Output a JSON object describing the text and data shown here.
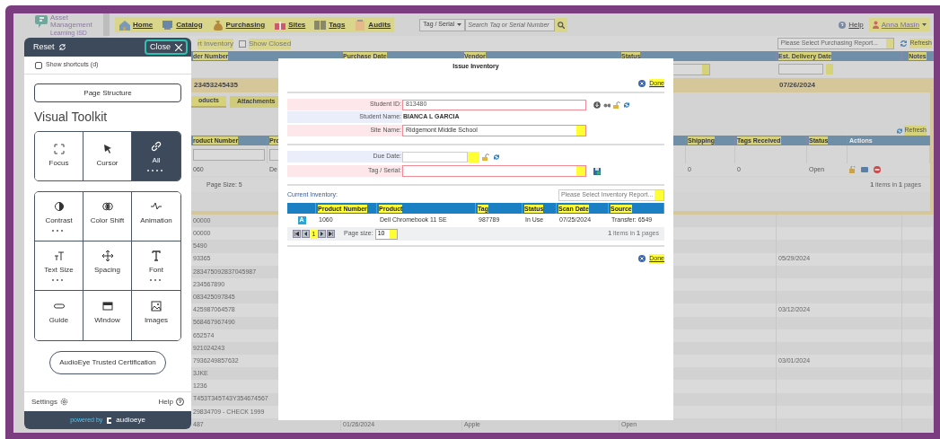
{
  "app": {
    "logo": {
      "line1": "Asset",
      "line2": "Management",
      "district": "Learning ISD"
    },
    "nav": [
      {
        "label": "Home"
      },
      {
        "label": "Catalog"
      },
      {
        "label": "Purchasing"
      },
      {
        "label": "Sites"
      },
      {
        "label": "Tags"
      },
      {
        "label": "Audits"
      }
    ],
    "search": {
      "type_select": "Tag / Serial",
      "placeholder": "Search Tag or Serial Number"
    },
    "help": "Help",
    "user": "Anna Masin"
  },
  "toolbar": {
    "import_link": "rt Inventory",
    "show_closed": {
      "label": "Show Closed",
      "checked": false
    },
    "report_select": {
      "placeholder": "Please Select Purchasing Report..."
    },
    "refresh": "Refresh"
  },
  "orders": {
    "columns": [
      "der Number",
      "Purchase Date",
      "Vendor",
      "Status",
      "Est. Delivery Date",
      "Notes"
    ],
    "expanded_row": {
      "order_number": "23453245435",
      "est_delivery_date": "07/26/2024"
    },
    "detail": {
      "tabs": [
        {
          "label": "oducts",
          "selected": true
        },
        {
          "label": "Attachments",
          "selected": false
        }
      ],
      "refresh": "Refresh",
      "columns": [
        "roduct Number",
        "Pro",
        "Shipping",
        "Tags Received",
        "Status",
        "Actions"
      ],
      "row": {
        "product_number": "060",
        "product": "De",
        "shipping": "0",
        "tags_received": "0",
        "status": "Open"
      },
      "page_size": "Page Size: 5",
      "summary": "**1** items in **1** pages"
    },
    "rows": [
      {
        "number": "00000"
      },
      {
        "number": "00000"
      },
      {
        "number": "5490"
      },
      {
        "number": "93365",
        "est_delivery_date": "05/29/2024"
      },
      {
        "number": "283475092837045987"
      },
      {
        "number": "234567890"
      },
      {
        "number": "083425097845"
      },
      {
        "number": "425987064578",
        "est_delivery_date": "03/12/2024"
      },
      {
        "number": "568467967490"
      },
      {
        "number": "652574"
      },
      {
        "number": "921024243"
      },
      {
        "number": "7936249857632",
        "est_delivery_date": "03/01/2024"
      },
      {
        "number": "3JKE"
      },
      {
        "number": "1236"
      },
      {
        "number": "T453T345T43Y354674567"
      },
      {
        "number": "29834709 - CHECK 1999"
      },
      {
        "number": "487",
        "purchase_date": "01/26/2024",
        "vendor": "Apple",
        "status": "Open"
      }
    ]
  },
  "toolkit": {
    "reset": "Reset",
    "close": "Close",
    "show_shortcuts": {
      "label": "Show shortcuts (d)",
      "checked": false
    },
    "page_structure": "Page Structure",
    "heading": "Visual Toolkit",
    "top_tools": [
      {
        "label": "Focus",
        "selected": false,
        "has_options": false
      },
      {
        "label": "Cursor",
        "selected": false,
        "has_options": false
      },
      {
        "label": "All",
        "selected": true,
        "has_options": true
      }
    ],
    "tools": [
      {
        "label": "Contrast",
        "has_options": true
      },
      {
        "label": "Color Shift",
        "has_options": false
      },
      {
        "label": "Animation",
        "has_options": false
      },
      {
        "label": "Text Size",
        "has_options": true
      },
      {
        "label": "Spacing",
        "has_options": false
      },
      {
        "label": "Font",
        "has_options": true
      },
      {
        "label": "Guide",
        "has_options": false
      },
      {
        "label": "Window",
        "has_options": false
      },
      {
        "label": "Images",
        "has_options": false
      }
    ],
    "certification": "AudioEye Trusted Certification",
    "settings": "Settings",
    "help": "Help",
    "powered_by": "powered by",
    "brand": "audioeye"
  },
  "modal": {
    "title": "Issue Inventory",
    "done": "Done",
    "student_id": {
      "label": "Student ID:",
      "value": "813480"
    },
    "student_name": {
      "label": "Student Name:",
      "value": "BIANCA L GARCIA"
    },
    "site_name": {
      "label": "Site Name:",
      "value": "Ridgemont Middle School"
    },
    "due_date": {
      "label": "Due Date:"
    },
    "tag_serial": {
      "label": "Tag / Serial:"
    },
    "current_inventory": "Current Inventory:",
    "inventory_report": {
      "placeholder": "Please Select Inventory Report..."
    },
    "columns": [
      "Product Number",
      "Product",
      "Tag",
      "Status",
      "Scan Date",
      "Source"
    ],
    "rows": [
      {
        "badge": "A",
        "cells": [
          "1060",
          "Dell Chromebook 11 SE",
          "987789",
          "In Use",
          "07/25/2024",
          "Transfer: 6549"
        ]
      }
    ],
    "pager": {
      "pages": [
        {
          "label": "1",
          "selected": true
        }
      ],
      "page_size_label": "Page size:",
      "page_size": "10",
      "summary": "**1** items in **1** pages"
    },
    "done_bottom": "Done"
  }
}
